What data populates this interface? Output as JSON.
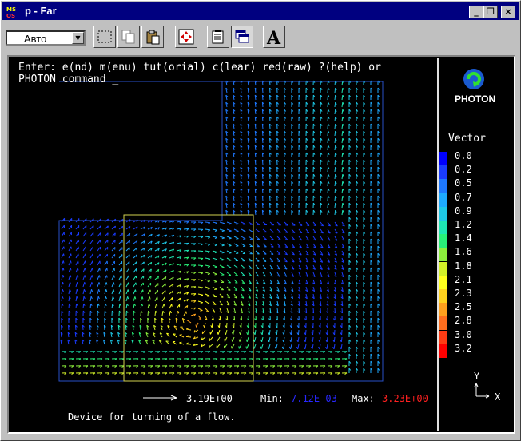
{
  "window": {
    "title": "p - Far",
    "app_badge": "MS\nOS"
  },
  "titlebar_buttons": {
    "minimize": "_",
    "restore": "❐",
    "close": "×"
  },
  "toolbar": {
    "combo_value": "Авто",
    "font_tool_label": "A"
  },
  "terminal": {
    "line1": "Enter: e(nd) m(enu) tut(orial) c(lear) red(raw) ?(help) or",
    "line2": "PHOTON command _"
  },
  "logo": {
    "text": "PHOTON"
  },
  "legend": {
    "title": "Vector",
    "entries": [
      {
        "label": "0.0",
        "color": "#0000ff"
      },
      {
        "label": "0.2",
        "color": "#1a3cff"
      },
      {
        "label": "0.5",
        "color": "#1e78ff"
      },
      {
        "label": "0.7",
        "color": "#1eaaff"
      },
      {
        "label": "0.9",
        "color": "#1ec8e6"
      },
      {
        "label": "1.2",
        "color": "#1ee6b4"
      },
      {
        "label": "1.4",
        "color": "#28f078"
      },
      {
        "label": "1.6",
        "color": "#8cf03c"
      },
      {
        "label": "1.8",
        "color": "#d2f028"
      },
      {
        "label": "2.1",
        "color": "#ffff1e"
      },
      {
        "label": "2.3",
        "color": "#ffd21e"
      },
      {
        "label": "2.5",
        "color": "#ffa01e"
      },
      {
        "label": "2.8",
        "color": "#ff6e1e"
      },
      {
        "label": "3.0",
        "color": "#ff3c14"
      },
      {
        "label": "3.2",
        "color": "#ff0000"
      }
    ]
  },
  "scale": {
    "reference_value": "3.19E+00",
    "min_label": "Min:",
    "min_value": "7.12E-03",
    "max_label": "Max:",
    "max_value": "3.23E+00",
    "min_color": "#2828ff",
    "max_color": "#ff2020"
  },
  "caption": "Device for turning of a flow.",
  "axes": {
    "y": "Y",
    "x": "X"
  },
  "colors": {
    "titlebar": "#000080",
    "plot_bg": "#000000",
    "outline_blue": "#2850c8",
    "outline_yellow": "#d2d250"
  }
}
